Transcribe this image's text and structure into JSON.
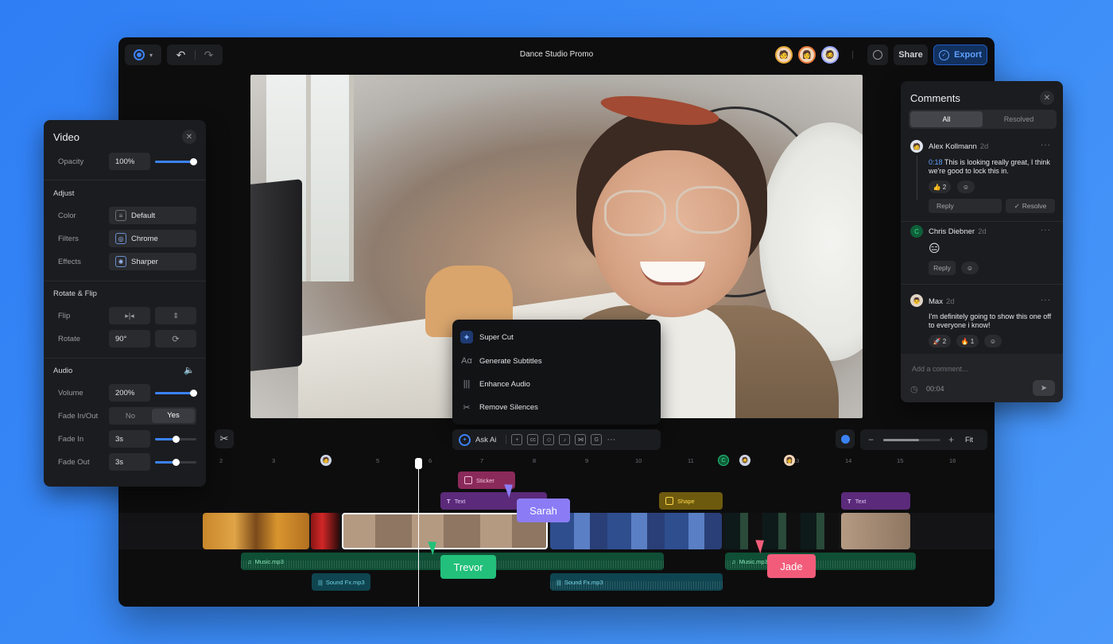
{
  "app": {
    "title": "Dance Studio Promo"
  },
  "topbar": {
    "share_label": "Share",
    "export_label": "Export",
    "collaborators": [
      "avatar-1",
      "avatar-2",
      "avatar-3"
    ]
  },
  "video_panel": {
    "title": "Video",
    "opacity_label": "Opacity",
    "opacity_value": "100%",
    "opacity_level": 1.0,
    "adjust_label": "Adjust",
    "color_label": "Color",
    "color_value": "Default",
    "filters_label": "Filters",
    "filters_value": "Chrome",
    "effects_label": "Effects",
    "effects_value": "Sharper",
    "rotate_flip_label": "Rotate & Flip",
    "flip_label": "Flip",
    "rotate_label": "Rotate",
    "rotate_value": "90°",
    "audio_label": "Audio",
    "volume_label": "Volume",
    "volume_value": "200%",
    "volume_level": 1.0,
    "fade_inout_label": "Fade In/Out",
    "fade_no": "No",
    "fade_yes": "Yes",
    "fade_in_label": "Fade In",
    "fade_in_value": "3s",
    "fade_in_level": 0.5,
    "fade_out_label": "Fade Out",
    "fade_out_value": "3s",
    "fade_out_level": 0.5
  },
  "ai_menu": {
    "items": [
      "Super Cut",
      "Generate Subtitles",
      "Enhance Audio",
      "Remove Silences"
    ]
  },
  "toolbar": {
    "ask_ai_label": "Ask Ai",
    "fit_label": "Fit",
    "zoom_level": 0.62
  },
  "ruler": {
    "ticks": [
      "2",
      "3",
      "5",
      "6",
      "7",
      "8",
      "9",
      "10",
      "11",
      "13",
      "14",
      "15",
      "16"
    ]
  },
  "timeline": {
    "sticker_label": "Sticker",
    "text_label_1": "Text",
    "shape_label": "Shape",
    "text_label_2": "Text",
    "music_1": "Music.mp3",
    "music_2": "Music.mp3",
    "sfx_1": "Sound Fx.mp3",
    "sfx_2": "Sound Fx.mp3"
  },
  "cursors": {
    "sarah": "Sarah",
    "trevor": "Trevor",
    "jade": "Jade"
  },
  "comments": {
    "title": "Comments",
    "tab_all": "All",
    "tab_resolved": "Resolved",
    "items": [
      {
        "name": "Alex Kollmann",
        "time": "2d",
        "timestamp": "0:18",
        "text": "This is looking really great, I think we're good to lock this in.",
        "reaction_count": "2",
        "reply_label": "Reply",
        "resolve_label": "Resolve"
      },
      {
        "name": "Chris Diebner",
        "time": "2d",
        "initial": "C",
        "reply_label": "Reply"
      },
      {
        "name": "Max",
        "time": "2d",
        "text": "I'm definitely going to show this one off to everyone i know!",
        "reaction_1_count": "2",
        "reaction_2_count": "1"
      }
    ],
    "input_placeholder": "Add a comment...",
    "input_time": "00:04"
  },
  "colors": {
    "accent": "#3b82f6",
    "sarah": "#8b7cf6",
    "trevor": "#22c07a",
    "jade": "#f25c7a"
  }
}
